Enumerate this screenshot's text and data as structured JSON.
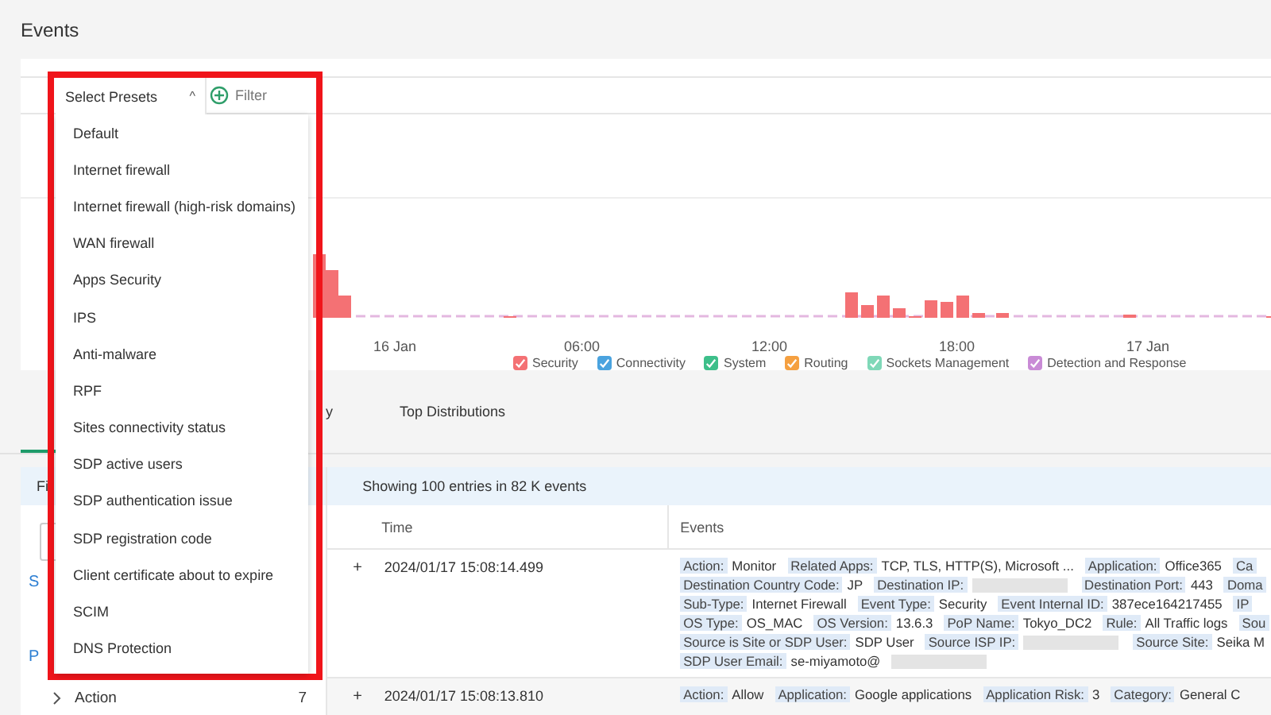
{
  "page_title": "Events",
  "toolbar": {
    "presets_label": "Select Presets",
    "presets_caret": "^",
    "filter_label": "Filter",
    "presets_expanded": true
  },
  "presets_menu": [
    "Default",
    "Internet firewall",
    "Internet firewall (high-risk domains)",
    "WAN firewall",
    "Apps Security",
    "IPS",
    "Anti-malware",
    "RPF",
    "Sites connectivity status",
    "SDP active users",
    "SDP authentication issue",
    "SDP registration code",
    "Client certificate about to expire",
    "SCIM",
    "DNS Protection"
  ],
  "chart": {
    "x_labels": [
      "16 Jan",
      "06:00",
      "12:00",
      "18:00",
      "17 Jan"
    ],
    "legend": [
      {
        "label": "Security",
        "color": "#f47174",
        "checked": true
      },
      {
        "label": "Connectivity",
        "color": "#4aa3df",
        "checked": true
      },
      {
        "label": "System",
        "color": "#3dbf8a",
        "checked": true
      },
      {
        "label": "Routing",
        "color": "#f5a040",
        "checked": true
      },
      {
        "label": "Sockets Management",
        "color": "#7fd8b8",
        "checked": true
      },
      {
        "label": "Detection and Response",
        "color": "#c98bd6",
        "checked": true
      }
    ]
  },
  "tabs": [
    {
      "label": "y",
      "selected": false
    },
    {
      "label": "Top Distributions",
      "selected": false
    }
  ],
  "filters_panel": {
    "header": "Fi",
    "link_1": "S",
    "link_2": "P",
    "groups": [
      {
        "label": "Action",
        "count": "7",
        "expanded": false
      }
    ]
  },
  "results": {
    "summary": "Showing 100 entries in 82 K events",
    "columns": [
      "Time",
      "Events"
    ],
    "rows": [
      {
        "expand": "+",
        "time": "2024/01/17 15:08:14.499",
        "lines": [
          [
            {
              "key": "Action:",
              "value": "Monitor"
            },
            {
              "key": "Related Apps:",
              "value": "TCP, TLS, HTTP(S), Microsoft ..."
            },
            {
              "key": "Application:",
              "value": "Office365"
            },
            {
              "key": "Ca"
            }
          ],
          [
            {
              "key": "Destination Country Code:",
              "value": "JP"
            },
            {
              "key": "Destination IP:",
              "redacted": true
            },
            {
              "key": "Destination Port:",
              "value": "443"
            },
            {
              "key": "Doma"
            }
          ],
          [
            {
              "key": "Sub-Type:",
              "value": "Internet Firewall"
            },
            {
              "key": "Event Type:",
              "value": "Security"
            },
            {
              "key": "Event Internal ID:",
              "value": "387ece164217455"
            },
            {
              "key": "IP"
            }
          ],
          [
            {
              "key": "OS Type:",
              "value": "OS_MAC"
            },
            {
              "key": "OS Version:",
              "value": "13.6.3"
            },
            {
              "key": "PoP Name:",
              "value": "Tokyo_DC2"
            },
            {
              "key": "Rule:",
              "value": "All Traffic logs"
            },
            {
              "key": "Sou"
            }
          ],
          [
            {
              "key": "Source is Site or SDP User:",
              "value": "SDP User"
            },
            {
              "key": "Source ISP IP:",
              "redacted": true
            },
            {
              "key": "Source Site:",
              "value": "Seika M"
            }
          ],
          [
            {
              "key": "SDP User Email:",
              "value": "se-miyamoto@",
              "redacted": true
            }
          ]
        ]
      },
      {
        "expand": "+",
        "time": "2024/01/17 15:08:13.810",
        "lines": [
          [
            {
              "key": "Action:",
              "value": "Allow"
            },
            {
              "key": "Application:",
              "value": "Google applications"
            },
            {
              "key": "Application Risk:",
              "value": "3"
            },
            {
              "key": "Category:",
              "value": "General C"
            }
          ]
        ]
      }
    ]
  }
}
